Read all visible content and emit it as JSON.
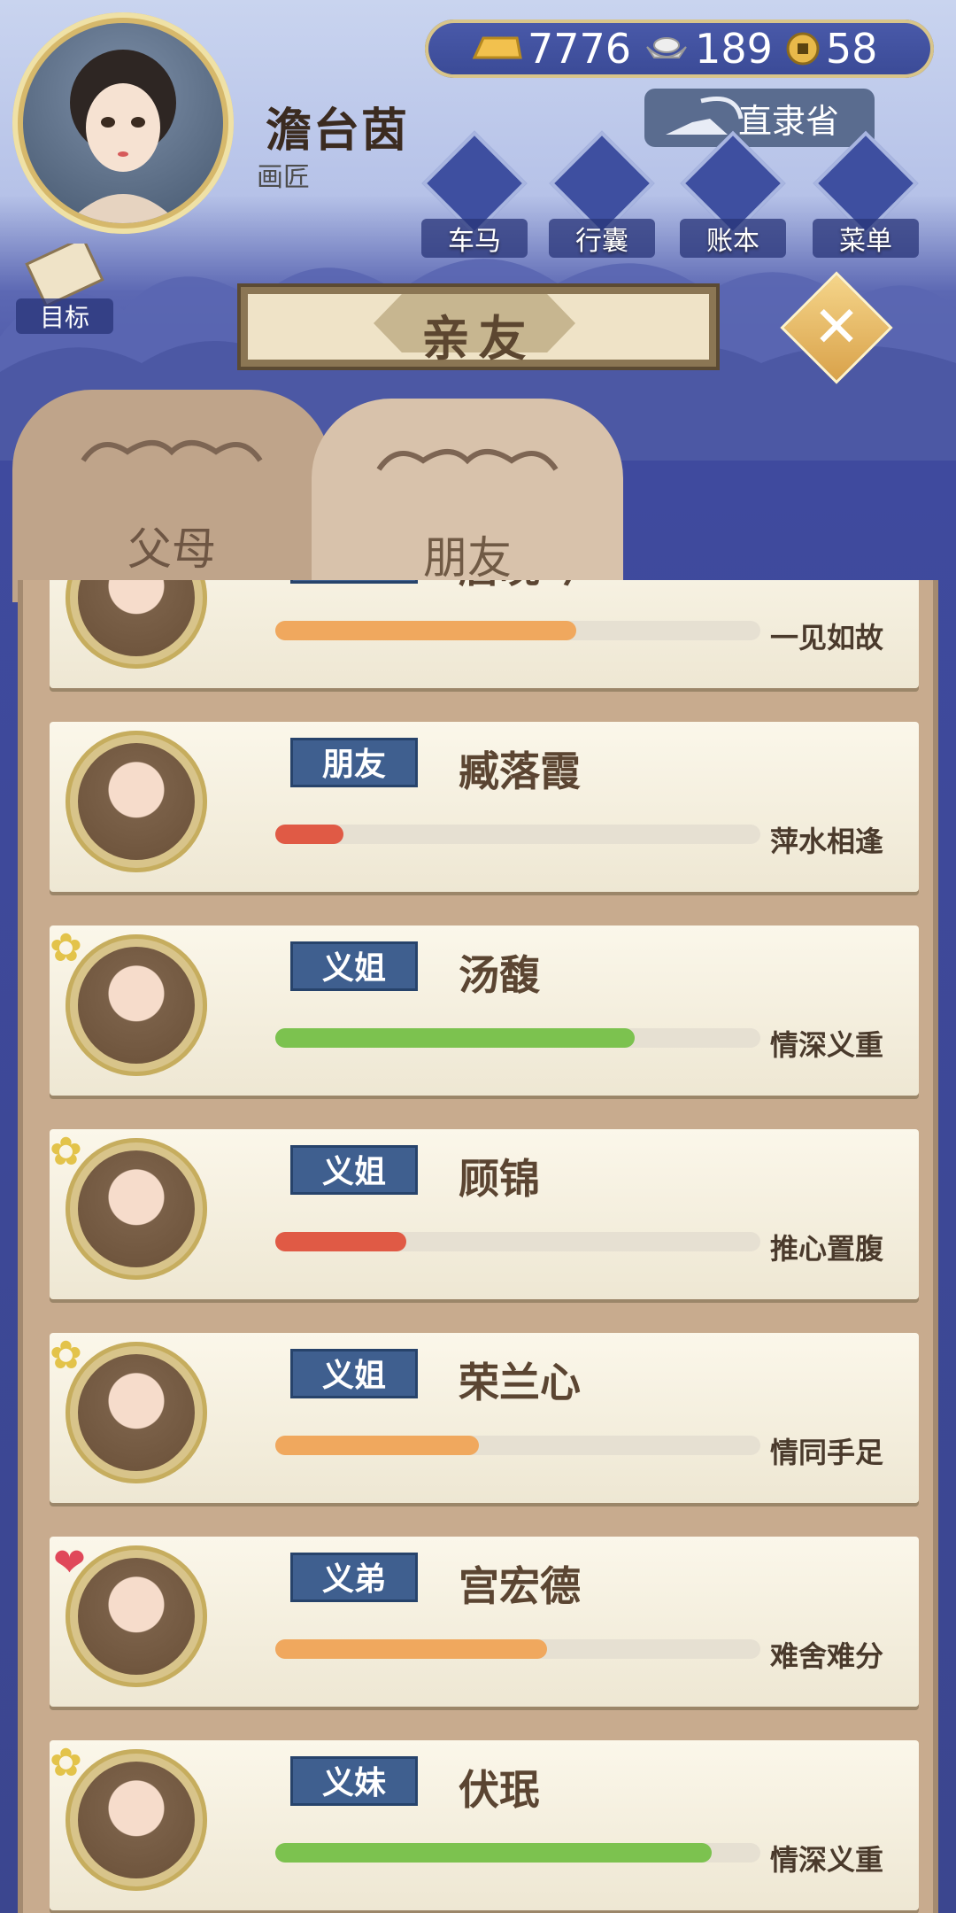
{
  "player": {
    "name": "澹台茵",
    "title": "画匠"
  },
  "currency": {
    "gold": "7776",
    "silver": "189",
    "coins": "58"
  },
  "location": "直隶省",
  "menu": [
    {
      "label": "车马",
      "icon": "carriage-icon"
    },
    {
      "label": "行囊",
      "icon": "bag-icon"
    },
    {
      "label": "账本",
      "icon": "ledger-icon"
    },
    {
      "label": "菜单",
      "icon": "more-icon"
    }
  ],
  "goal_label": "目标",
  "page_title": "亲友",
  "tabs": [
    {
      "label": "父母",
      "active": false
    },
    {
      "label": "朋友",
      "active": true
    }
  ],
  "colors": {
    "bar_orange": "#f0a85e",
    "bar_red": "#e05a45",
    "bar_green": "#7cc24f",
    "tag_blue": "#3f5f8f"
  },
  "friends": [
    {
      "name": "唐晚吟",
      "relation": "朋友",
      "status": "一见如故",
      "affinity": 0.62,
      "bar_color": "orange",
      "badge": ""
    },
    {
      "name": "臧落霞",
      "relation": "朋友",
      "status": "萍水相逢",
      "affinity": 0.14,
      "bar_color": "red",
      "badge": ""
    },
    {
      "name": "汤馥",
      "relation": "义姐",
      "status": "情深义重",
      "affinity": 0.74,
      "bar_color": "green",
      "badge": "knot"
    },
    {
      "name": "顾锦",
      "relation": "义姐",
      "status": "推心置腹",
      "affinity": 0.27,
      "bar_color": "red",
      "badge": "knot"
    },
    {
      "name": "荣兰心",
      "relation": "义姐",
      "status": "情同手足",
      "affinity": 0.42,
      "bar_color": "orange",
      "badge": "knot"
    },
    {
      "name": "宫宏德",
      "relation": "义弟",
      "status": "难舍难分",
      "affinity": 0.56,
      "bar_color": "orange",
      "badge": "heart"
    },
    {
      "name": "伏珉",
      "relation": "义妹",
      "status": "情深义重",
      "affinity": 0.9,
      "bar_color": "green",
      "badge": "knot"
    }
  ]
}
